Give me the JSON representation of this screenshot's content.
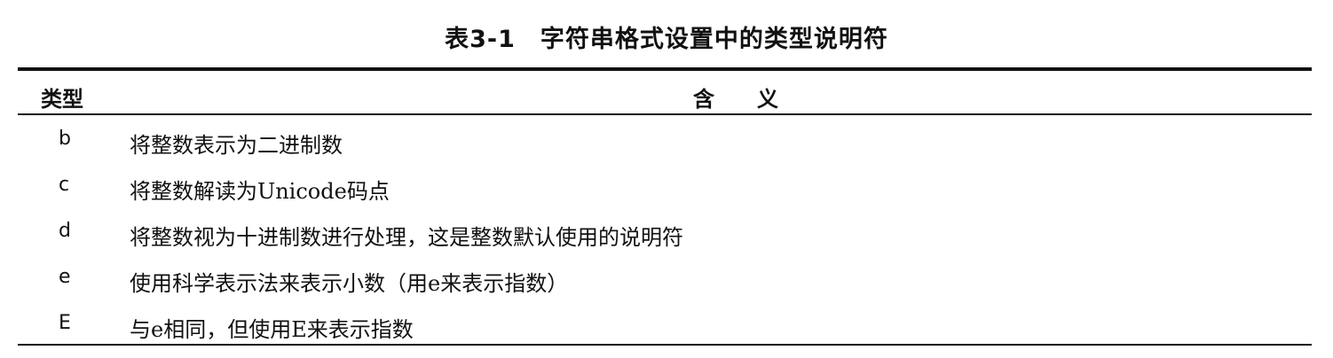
{
  "title": "表3-1　字符串格式设置中的类型说明符",
  "table": {
    "headers": {
      "type": "类型",
      "meaning": "含　　义"
    },
    "rows": [
      {
        "type": "b",
        "meaning": "将整数表示为二进制数"
      },
      {
        "type": "c",
        "meaning": "将整数解读为Unicode码点"
      },
      {
        "type": "d",
        "meaning": "将整数视为十进制数进行处理，这是整数默认使用的说明符"
      },
      {
        "type": "e",
        "meaning": "使用科学表示法来表示小数（用e来表示指数）"
      },
      {
        "type": "E",
        "meaning": "与e相同，但使用E来表示指数"
      }
    ]
  }
}
